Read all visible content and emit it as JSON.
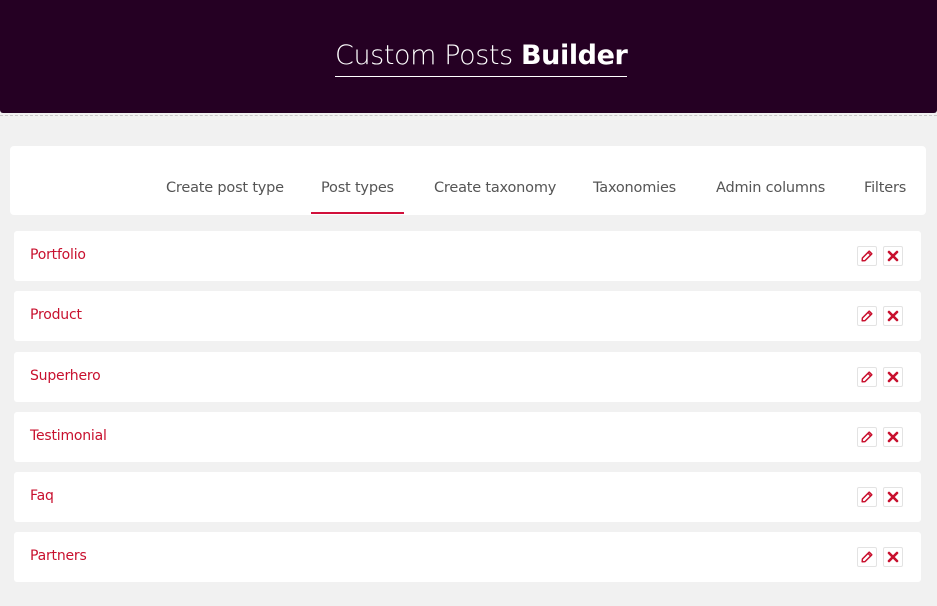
{
  "header": {
    "title_light": "Custom Posts ",
    "title_bold": "Builder",
    "background": "#250023"
  },
  "tabs": [
    {
      "label": "Create post type",
      "active": false
    },
    {
      "label": "Post types",
      "active": true
    },
    {
      "label": "Create taxonomy",
      "active": false
    },
    {
      "label": "Taxonomies",
      "active": false
    },
    {
      "label": "Admin columns",
      "active": false
    },
    {
      "label": "Filters",
      "active": false
    }
  ],
  "post_types": [
    {
      "name": "Portfolio"
    },
    {
      "name": "Product"
    },
    {
      "name": "Superhero"
    },
    {
      "name": "Testimonial"
    },
    {
      "name": "Faq"
    },
    {
      "name": "Partners"
    }
  ],
  "row_actions": {
    "edit_icon": "pencil-icon",
    "delete_icon": "close-icon"
  },
  "colors": {
    "accent": "#d1103b",
    "link": "#c8102e",
    "tab_text": "#555555"
  }
}
